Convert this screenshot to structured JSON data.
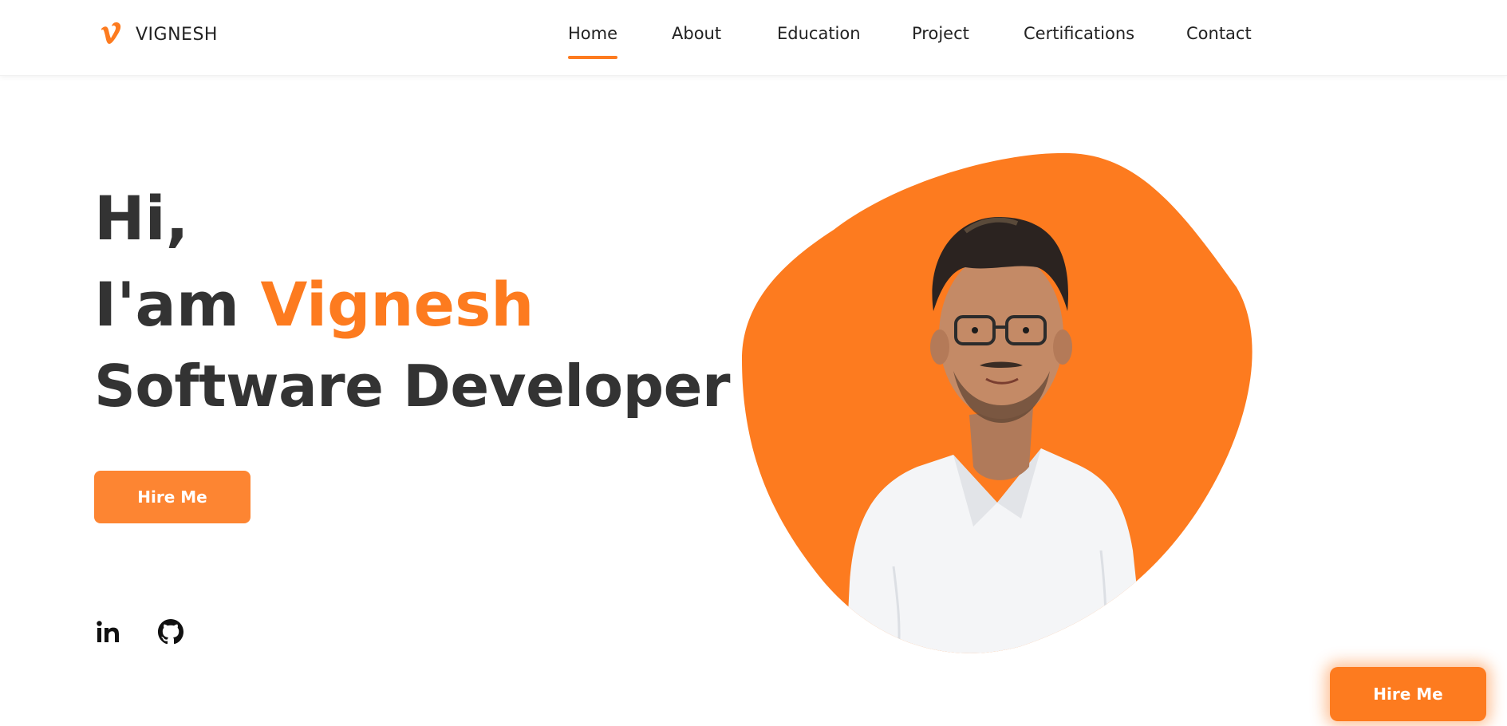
{
  "brand": {
    "logo_icon": "vimeo-v-logo-icon",
    "name": "VIGNESH",
    "accent_color": "#fd7b1f"
  },
  "nav": {
    "items": [
      {
        "label": "Home",
        "active": true
      },
      {
        "label": "About",
        "active": false
      },
      {
        "label": "Education",
        "active": false
      },
      {
        "label": "Project",
        "active": false
      },
      {
        "label": "Certifications",
        "active": false
      },
      {
        "label": "Contact",
        "active": false
      }
    ]
  },
  "hero": {
    "greeting": "Hi,",
    "intro_prefix": "I'am ",
    "name": "Vignesh",
    "role": "Software Developer",
    "cta_label": "Hire Me",
    "social": [
      {
        "icon": "linkedin-icon"
      },
      {
        "icon": "github-icon"
      }
    ],
    "portrait_icon": "profile-photo"
  },
  "floating_cta": {
    "label": "Hire Me"
  }
}
